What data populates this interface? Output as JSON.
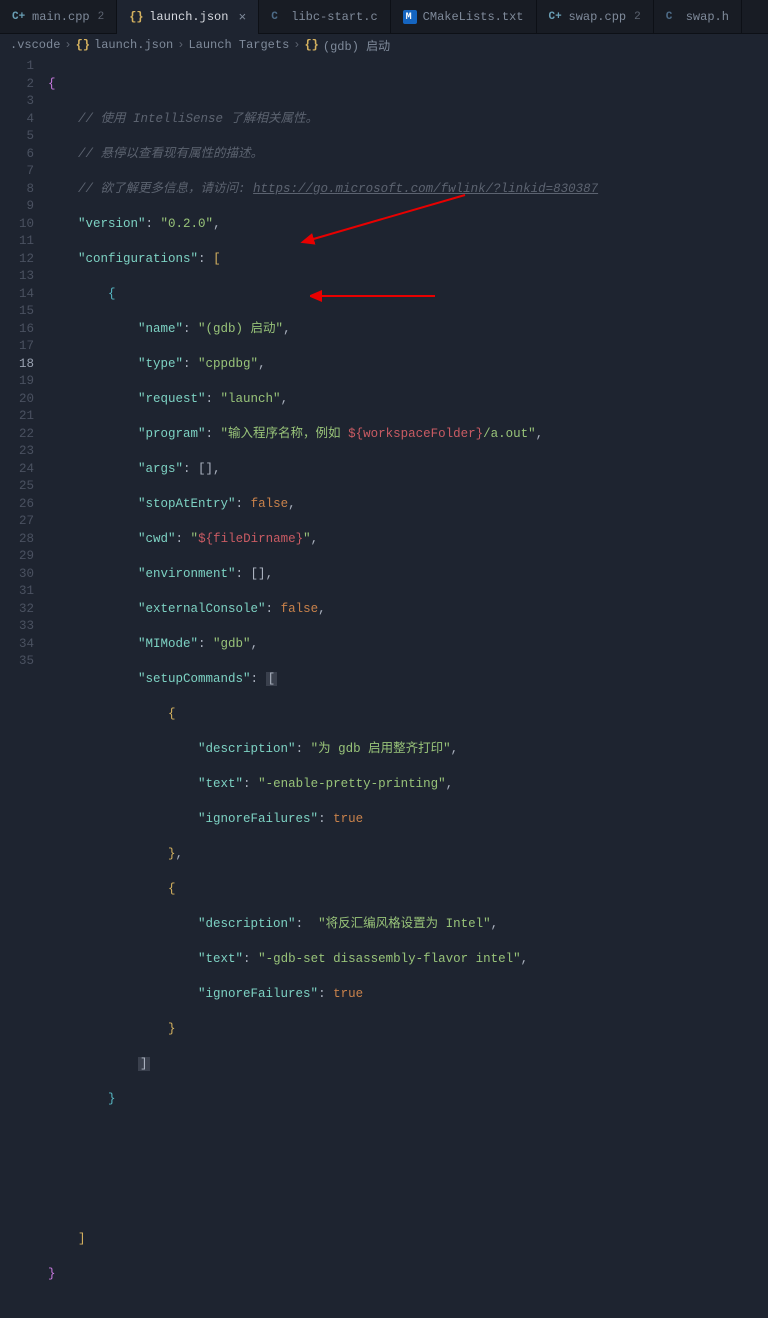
{
  "tabs": [
    {
      "icon": "cpp",
      "label": "main.cpp",
      "badge": "2",
      "active": false
    },
    {
      "icon": "json",
      "label": "launch.json",
      "active": true,
      "close": "×"
    },
    {
      "icon": "c",
      "label": "libc-start.c",
      "active": false
    },
    {
      "icon": "cmake",
      "label": "CMakeLists.txt",
      "active": false
    },
    {
      "icon": "cpp",
      "label": "swap.cpp",
      "badge": "2",
      "active": false
    },
    {
      "icon": "c",
      "label": "swap.h",
      "active": false
    }
  ],
  "breadcrumbs": {
    "parts": [
      ".vscode",
      "launch.json",
      "Launch Targets",
      "(gdb) 启动"
    ],
    "icons": [
      "",
      "{}",
      "",
      "{}"
    ]
  },
  "lines": {
    "total": 35,
    "current": 18
  },
  "code": {
    "comment1": "// 使用 IntelliSense 了解相关属性。",
    "comment2": "// 悬停以查看现有属性的描述。",
    "comment3a": "// 欲了解更多信息，请访问:",
    "comment3b": "https://go.microsoft.com/fwlink/?linkid=830387",
    "version_key": "\"version\"",
    "version_val": "\"0.2.0\"",
    "configurations_key": "\"configurations\"",
    "name_key": "\"name\"",
    "name_val": "\"(gdb) 启动\"",
    "type_key": "\"type\"",
    "type_val": "\"cppdbg\"",
    "request_key": "\"request\"",
    "request_val": "\"launch\"",
    "program_key": "\"program\"",
    "program_val_a": "\"输入程序名称，例如 ",
    "program_val_b": "${workspaceFolder}",
    "program_val_c": "/a.out\"",
    "args_key": "\"args\"",
    "stopAtEntry_key": "\"stopAtEntry\"",
    "false_kw": "false",
    "true_kw": "true",
    "cwd_key": "\"cwd\"",
    "cwd_val_a": "\"",
    "cwd_val_b": "${fileDirname}",
    "cwd_val_c": "\"",
    "environment_key": "\"environment\"",
    "externalConsole_key": "\"externalConsole\"",
    "MIMode_key": "\"MIMode\"",
    "MIMode_val": "\"gdb\"",
    "setupCommands_key": "\"setupCommands\"",
    "description_key": "\"description\"",
    "description_val1": "\"为 gdb 启用整齐打印\"",
    "text_key": "\"text\"",
    "text_val1": "\"-enable-pretty-printing\"",
    "ignoreFailures_key": "\"ignoreFailures\"",
    "description_val2": " \"将反汇编风格设置为 Intel\"",
    "text_val2": "\"-gdb-set disassembly-flavor intel\""
  }
}
